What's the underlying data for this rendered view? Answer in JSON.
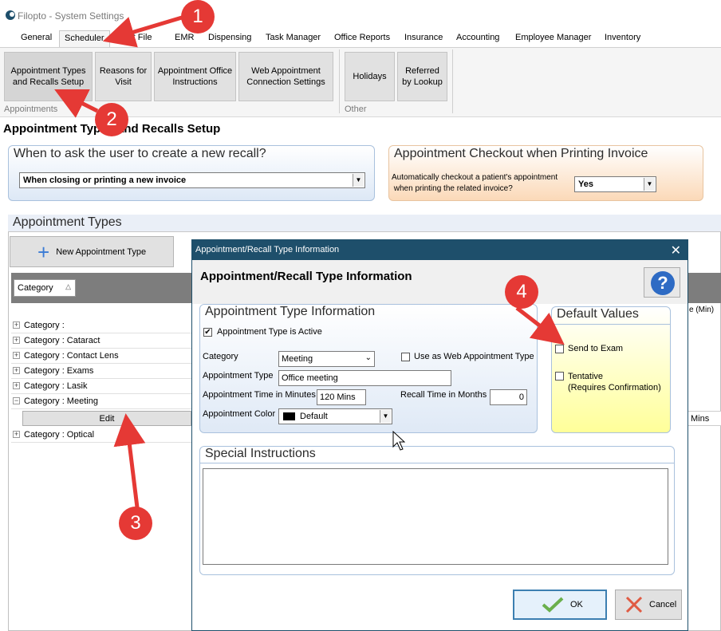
{
  "app": {
    "title": "Filopto - System Settings"
  },
  "tabs": [
    "General",
    "Scheduler",
    "Patient File",
    "EMR",
    "Dispensing",
    "Task Manager",
    "Office Reports",
    "Insurance",
    "Accounting",
    "Employee Manager",
    "Inventory"
  ],
  "tab_visible": {
    "patient_file": "ient File"
  },
  "ribbon": {
    "buttons": [
      "Appointment Types\nand Recalls Setup",
      "Reasons for\nVisit",
      "Appointment Office\nInstructions",
      "Web Appointment\nConnection Settings",
      "Holidays",
      "Referred\nby Lookup"
    ],
    "groups": [
      "Appointments",
      "Other"
    ]
  },
  "page": {
    "title": "Appointment Types and Recalls Setup"
  },
  "recall_panel": {
    "title": "When to ask the user to create a new recall?",
    "value": "When closing or printing a new invoice"
  },
  "checkout_panel": {
    "title": "Appointment Checkout when Printing Invoice",
    "question": "Automatically checkout a patient's appointment\n when printing the related invoice?",
    "value": "Yes"
  },
  "appt_types": {
    "title": "Appointment Types",
    "new_button": "New Appointment Type",
    "category_header": "Category",
    "categories": [
      "Category :",
      "Category : Cataract",
      "Category : Contact Lens",
      "Category : Exams",
      "Category : Lasik",
      "Category : Meeting",
      "Category : Optical"
    ],
    "edit_label": "Edit",
    "right_header": "e (Min)",
    "right_cell": "Mins"
  },
  "dialog": {
    "titlebar": "Appointment/Recall Type Information",
    "heading": "Appointment/Recall Type Information",
    "help": "?",
    "info": {
      "title": "Appointment Type Information",
      "active_label": "Appointment Type is Active",
      "category_label": "Category",
      "category_value": "Meeting",
      "web_label": "Use as Web Appointment Type",
      "type_label": "Appointment Type",
      "type_value": "Office meeting",
      "time_label": "Appointment Time in Minutes",
      "time_value": "120 Mins",
      "recall_label": "Recall Time in Months",
      "recall_value": "0",
      "color_label": "Appointment Color",
      "color_value": "Default"
    },
    "defaults": {
      "title": "Default Values",
      "send_exam": "Send to Exam",
      "tentative": "Tentative\n(Requires Confirmation)"
    },
    "special": {
      "title": "Special Instructions"
    },
    "ok": "OK",
    "cancel": "Cancel"
  },
  "annotations": {
    "badges": [
      "1",
      "2",
      "3",
      "4"
    ],
    "color": "#e53935"
  }
}
